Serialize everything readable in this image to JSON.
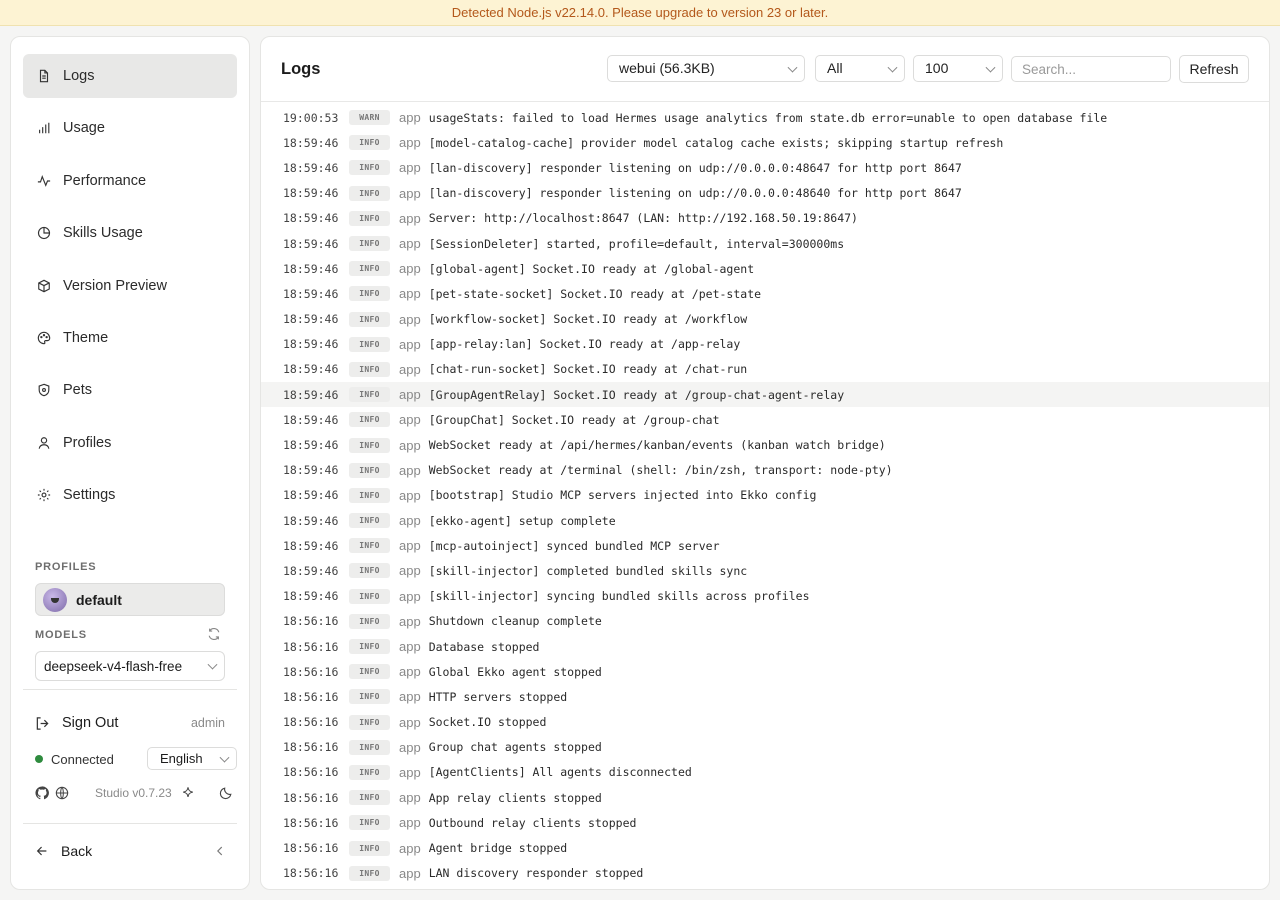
{
  "banner": {
    "text": "Detected Node.js v22.14.0. Please upgrade to version 23 or later."
  },
  "sidebar": {
    "items": [
      {
        "label": "Logs",
        "icon": "file-text-icon",
        "active": true
      },
      {
        "label": "Usage",
        "icon": "bar-chart-icon"
      },
      {
        "label": "Performance",
        "icon": "activity-icon"
      },
      {
        "label": "Skills Usage",
        "icon": "pie-chart-icon"
      },
      {
        "label": "Version Preview",
        "icon": "package-icon"
      },
      {
        "label": "Theme",
        "icon": "palette-icon"
      },
      {
        "label": "Pets",
        "icon": "shield-icon"
      },
      {
        "label": "Profiles",
        "icon": "user-icon"
      },
      {
        "label": "Settings",
        "icon": "gear-icon"
      }
    ],
    "profiles_label": "PROFILES",
    "profile_name": "default",
    "models_label": "MODELS",
    "model_value": "deepseek-v4-flash-free",
    "sign_out": "Sign Out",
    "user": "admin",
    "status": "Connected",
    "status_color": "#2e8b3e",
    "language": "English",
    "version": "Studio v0.7.23",
    "back": "Back"
  },
  "main": {
    "title": "Logs",
    "source_select": "webui (56.3KB)",
    "level_select": "All",
    "limit_select": "100",
    "search_placeholder": "Search...",
    "refresh": "Refresh",
    "logs": [
      {
        "time": "19:00:53",
        "level": "WARN",
        "source": "app",
        "message": "usageStats: failed to load Hermes usage analytics from state.db error=unable to open database file"
      },
      {
        "time": "18:59:46",
        "level": "INFO",
        "source": "app",
        "message": "[model-catalog-cache] provider model catalog cache exists; skipping startup refresh"
      },
      {
        "time": "18:59:46",
        "level": "INFO",
        "source": "app",
        "message": "[lan-discovery] responder listening on udp://0.0.0.0:48647 for http port 8647"
      },
      {
        "time": "18:59:46",
        "level": "INFO",
        "source": "app",
        "message": "[lan-discovery] responder listening on udp://0.0.0.0:48640 for http port 8647"
      },
      {
        "time": "18:59:46",
        "level": "INFO",
        "source": "app",
        "message": "Server: http://localhost:8647 (LAN: http://192.168.50.19:8647)"
      },
      {
        "time": "18:59:46",
        "level": "INFO",
        "source": "app",
        "message": "[SessionDeleter] started, profile=default, interval=300000ms"
      },
      {
        "time": "18:59:46",
        "level": "INFO",
        "source": "app",
        "message": "[global-agent] Socket.IO ready at /global-agent"
      },
      {
        "time": "18:59:46",
        "level": "INFO",
        "source": "app",
        "message": "[pet-state-socket] Socket.IO ready at /pet-state"
      },
      {
        "time": "18:59:46",
        "level": "INFO",
        "source": "app",
        "message": "[workflow-socket] Socket.IO ready at /workflow"
      },
      {
        "time": "18:59:46",
        "level": "INFO",
        "source": "app",
        "message": "[app-relay:lan] Socket.IO ready at /app-relay"
      },
      {
        "time": "18:59:46",
        "level": "INFO",
        "source": "app",
        "message": "[chat-run-socket] Socket.IO ready at /chat-run"
      },
      {
        "time": "18:59:46",
        "level": "INFO",
        "source": "app",
        "message": "[GroupAgentRelay] Socket.IO ready at /group-chat-agent-relay"
      },
      {
        "time": "18:59:46",
        "level": "INFO",
        "source": "app",
        "message": "[GroupChat] Socket.IO ready at /group-chat"
      },
      {
        "time": "18:59:46",
        "level": "INFO",
        "source": "app",
        "message": "WebSocket ready at /api/hermes/kanban/events (kanban watch bridge)"
      },
      {
        "time": "18:59:46",
        "level": "INFO",
        "source": "app",
        "message": "WebSocket ready at /terminal (shell: /bin/zsh, transport: node-pty)"
      },
      {
        "time": "18:59:46",
        "level": "INFO",
        "source": "app",
        "message": "[bootstrap] Studio MCP servers injected into Ekko config"
      },
      {
        "time": "18:59:46",
        "level": "INFO",
        "source": "app",
        "message": "[ekko-agent] setup complete"
      },
      {
        "time": "18:59:46",
        "level": "INFO",
        "source": "app",
        "message": "[mcp-autoinject] synced bundled MCP server"
      },
      {
        "time": "18:59:46",
        "level": "INFO",
        "source": "app",
        "message": "[skill-injector] completed bundled skills sync"
      },
      {
        "time": "18:59:46",
        "level": "INFO",
        "source": "app",
        "message": "[skill-injector] syncing bundled skills across profiles"
      },
      {
        "time": "18:56:16",
        "level": "INFO",
        "source": "app",
        "message": "Shutdown cleanup complete"
      },
      {
        "time": "18:56:16",
        "level": "INFO",
        "source": "app",
        "message": "Database stopped"
      },
      {
        "time": "18:56:16",
        "level": "INFO",
        "source": "app",
        "message": "Global Ekko agent stopped"
      },
      {
        "time": "18:56:16",
        "level": "INFO",
        "source": "app",
        "message": "HTTP servers stopped"
      },
      {
        "time": "18:56:16",
        "level": "INFO",
        "source": "app",
        "message": "Socket.IO stopped"
      },
      {
        "time": "18:56:16",
        "level": "INFO",
        "source": "app",
        "message": "Group chat agents stopped"
      },
      {
        "time": "18:56:16",
        "level": "INFO",
        "source": "app",
        "message": "[AgentClients] All agents disconnected"
      },
      {
        "time": "18:56:16",
        "level": "INFO",
        "source": "app",
        "message": "App relay clients stopped"
      },
      {
        "time": "18:56:16",
        "level": "INFO",
        "source": "app",
        "message": "Outbound relay clients stopped"
      },
      {
        "time": "18:56:16",
        "level": "INFO",
        "source": "app",
        "message": "Agent bridge stopped"
      },
      {
        "time": "18:56:16",
        "level": "INFO",
        "source": "app",
        "message": "LAN discovery responder stopped"
      }
    ]
  }
}
